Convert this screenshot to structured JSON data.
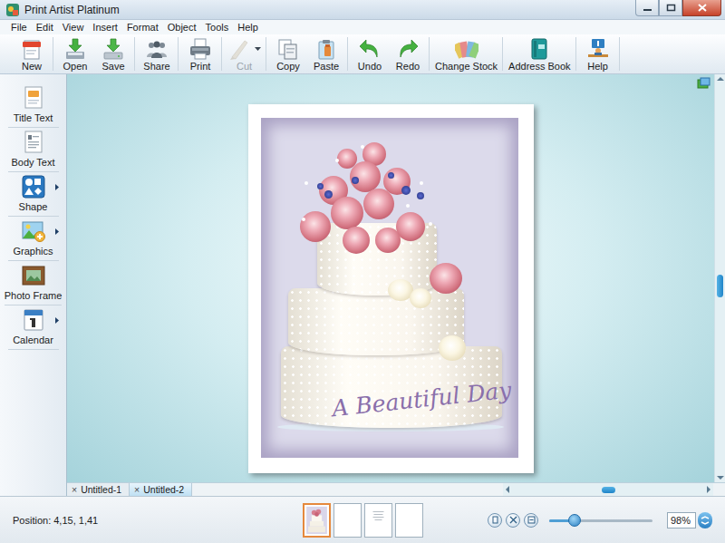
{
  "window": {
    "title": "Print Artist Platinum"
  },
  "menu": [
    "File",
    "Edit",
    "View",
    "Insert",
    "Format",
    "Object",
    "Tools",
    "Help"
  ],
  "toolbar": [
    [
      {
        "label": "New",
        "disabled": false,
        "dropdown": false
      }
    ],
    [
      {
        "label": "Open",
        "disabled": false,
        "dropdown": false
      },
      {
        "label": "Save",
        "disabled": false,
        "dropdown": false
      }
    ],
    [
      {
        "label": "Share",
        "disabled": false,
        "dropdown": false
      }
    ],
    [
      {
        "label": "Print",
        "disabled": false,
        "dropdown": false
      }
    ],
    [
      {
        "label": "Cut",
        "disabled": true,
        "dropdown": true
      }
    ],
    [
      {
        "label": "Copy",
        "disabled": false,
        "dropdown": false
      },
      {
        "label": "Paste",
        "disabled": false,
        "dropdown": false
      }
    ],
    [
      {
        "label": "Undo",
        "disabled": false,
        "dropdown": false
      },
      {
        "label": "Redo",
        "disabled": false,
        "dropdown": false
      }
    ],
    [
      {
        "label": "Change Stock",
        "disabled": false,
        "dropdown": false
      }
    ],
    [
      {
        "label": "Address Book",
        "disabled": false,
        "dropdown": false
      }
    ],
    [
      {
        "label": "Help",
        "disabled": false,
        "dropdown": false
      }
    ]
  ],
  "sidebar": {
    "items": [
      {
        "label": "Title Text",
        "submenu": false
      },
      {
        "label": "Body Text",
        "submenu": false
      },
      {
        "label": "Shape",
        "submenu": true
      },
      {
        "label": "Graphics",
        "submenu": true
      },
      {
        "label": "Photo Frame",
        "submenu": false
      },
      {
        "label": "Calendar",
        "submenu": true
      }
    ]
  },
  "card": {
    "caption": "A Beautiful Day"
  },
  "scroll": {
    "vertical": {
      "level": 0.52
    },
    "horizontal": {
      "level": 0.5
    }
  },
  "tabs": [
    {
      "label": "Untitled-1",
      "close": "×",
      "selected": false
    },
    {
      "label": "Untitled-2",
      "close": "×",
      "selected": true
    }
  ],
  "status_bar": {
    "position": "Position: 4,15, 1,41",
    "pages": [
      {
        "kind": "photo",
        "selected": true
      },
      {
        "kind": "blank",
        "selected": false
      },
      {
        "kind": "text",
        "selected": false
      },
      {
        "kind": "blank",
        "selected": false
      }
    ],
    "zoom": {
      "level": 0.21,
      "reading": "98%"
    }
  }
}
